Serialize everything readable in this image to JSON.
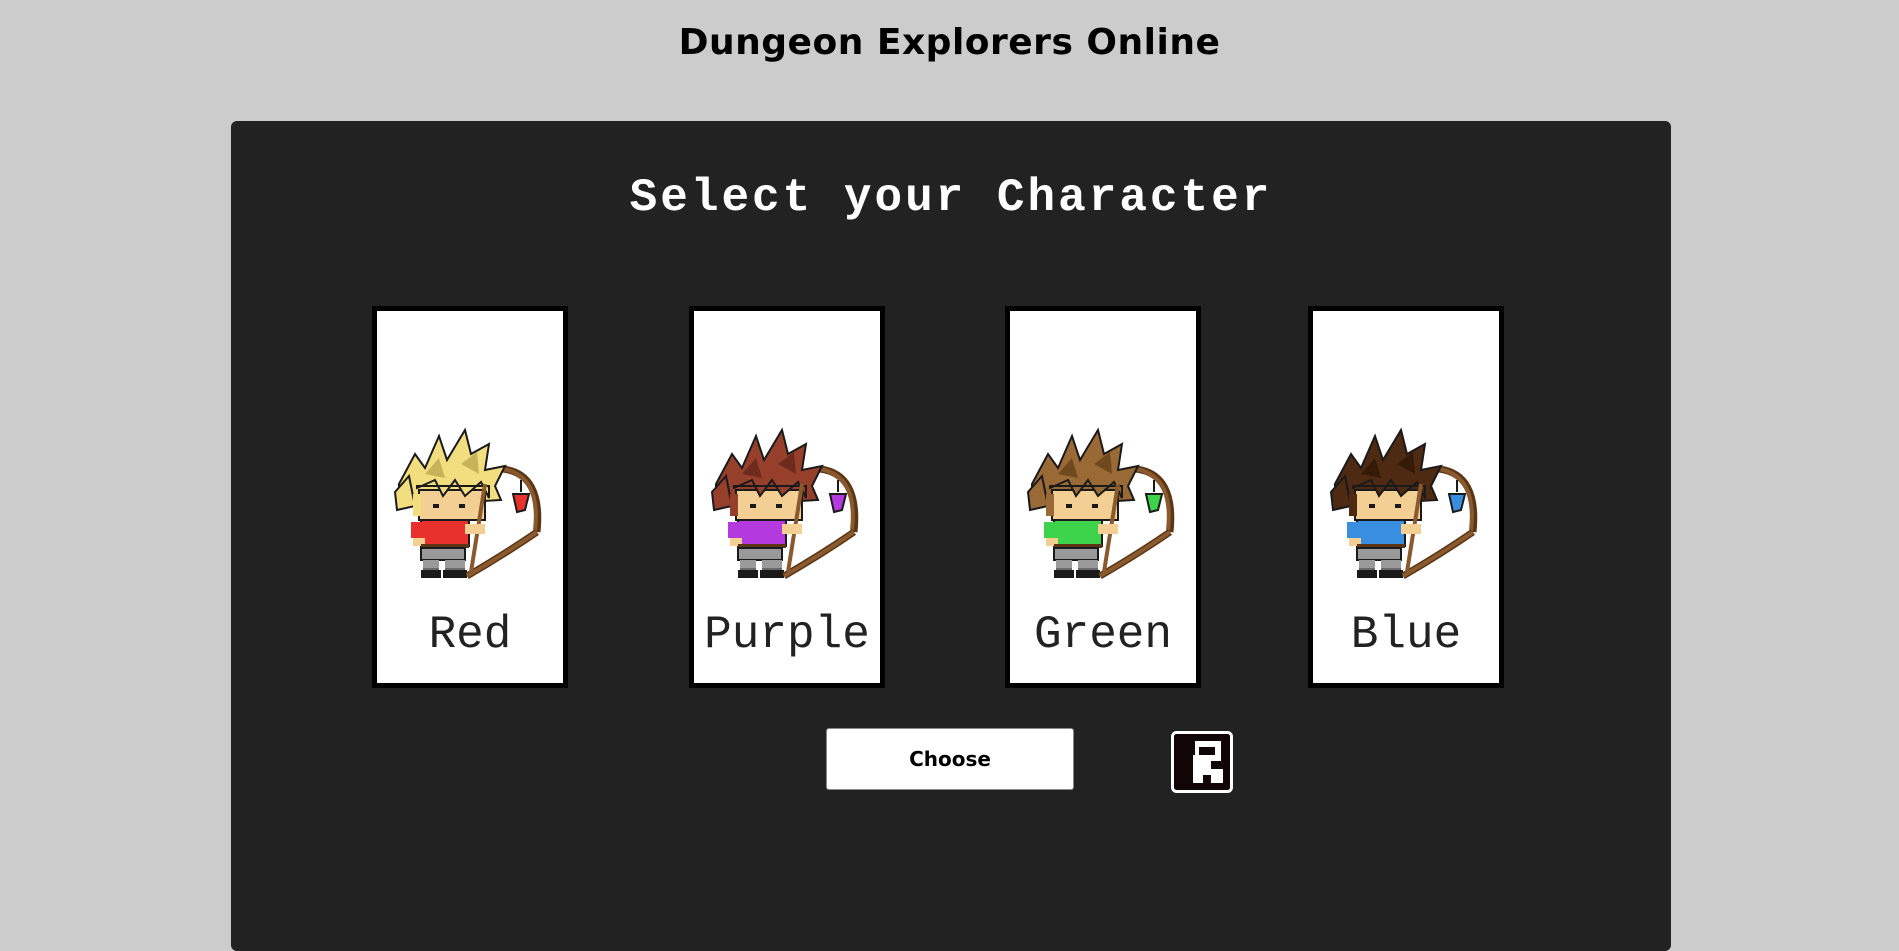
{
  "site": {
    "title": "Dungeon Explorers Online"
  },
  "character_select": {
    "title": "Select your Character",
    "characters": [
      {
        "label": "Red",
        "shirt_color": "#e8302c",
        "hair_color": "#f2de7e",
        "hair_shade": "#c9b35a",
        "gem_color": "#e8302c"
      },
      {
        "label": "Purple",
        "shirt_color": "#b43ae0",
        "hair_color": "#96402c",
        "hair_shade": "#6e2a1c",
        "gem_color": "#b43ae0"
      },
      {
        "label": "Green",
        "shirt_color": "#3cd24a",
        "hair_color": "#9a6a36",
        "hair_shade": "#70491f",
        "gem_color": "#3cd24a"
      },
      {
        "label": "Blue",
        "shirt_color": "#3a8ee0",
        "hair_color": "#4e2a12",
        "hair_shade": "#361a08",
        "gem_color": "#3a8ee0"
      }
    ],
    "choose_button": "Choose",
    "logo_icon": "maze-logo-icon"
  },
  "colors": {
    "page_background": "#cccccc",
    "panel_background": "#222222",
    "card_background": "#ffffff"
  }
}
